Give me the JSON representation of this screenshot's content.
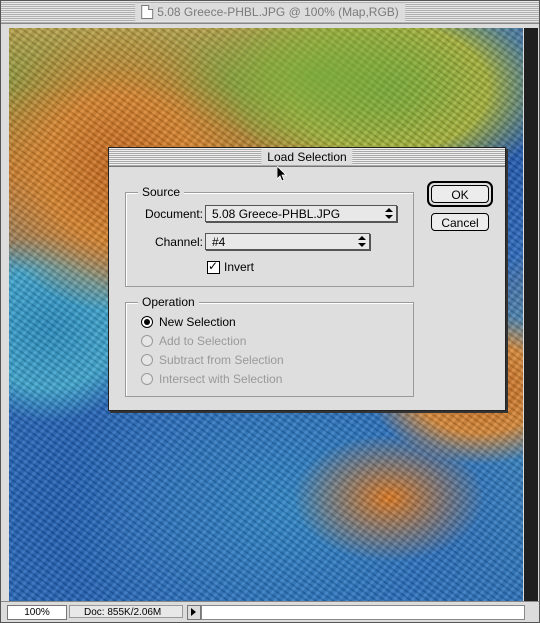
{
  "window": {
    "title": "5.08 Greece-PHBL.JPG @ 100% (Map,RGB)"
  },
  "dialog": {
    "title": "Load Selection",
    "source": {
      "group_title": "Source",
      "document_label": "Document:",
      "document_value": "5.08 Greece-PHBL.JPG",
      "channel_label": "Channel:",
      "channel_value": "#4",
      "invert_label": "Invert",
      "invert_checked": true
    },
    "operation": {
      "group_title": "Operation",
      "options": [
        {
          "label": "New Selection",
          "selected": true,
          "enabled": true
        },
        {
          "label": "Add to Selection",
          "selected": false,
          "enabled": false
        },
        {
          "label": "Subtract from Selection",
          "selected": false,
          "enabled": false
        },
        {
          "label": "Intersect with Selection",
          "selected": false,
          "enabled": false
        }
      ]
    },
    "buttons": {
      "ok": "OK",
      "cancel": "Cancel"
    }
  },
  "statusbar": {
    "zoom": "100%",
    "doc_size": "Doc: 855K/2.06M"
  }
}
